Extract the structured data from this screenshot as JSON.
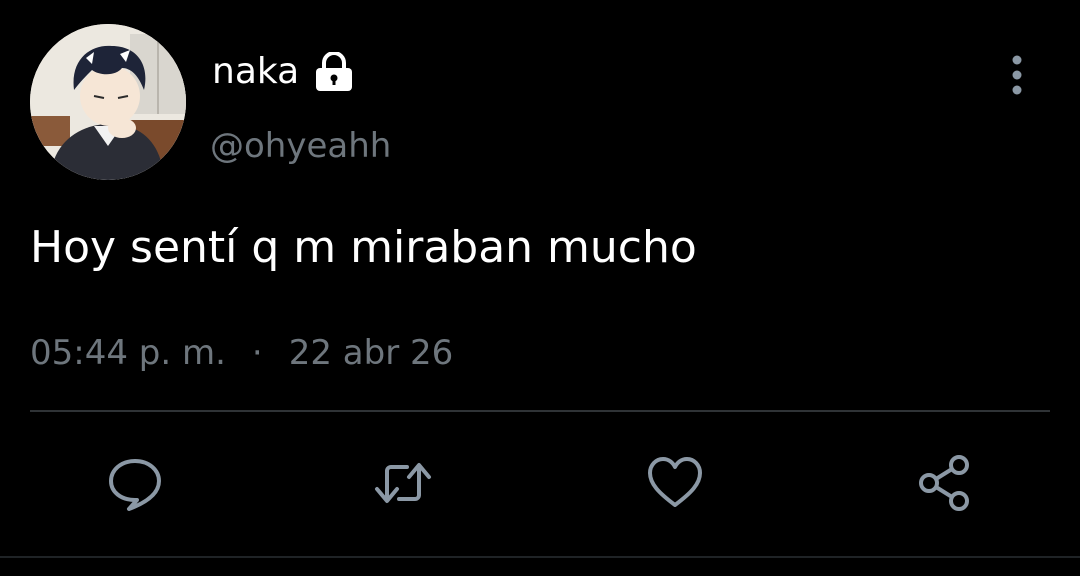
{
  "tweet": {
    "display_name": "naka",
    "handle": "@ohyeahh",
    "protected": true,
    "text": "Hoy sentí q m miraban mucho",
    "time": "05:44 p. m.",
    "separator": "·",
    "date": "22 abr 26"
  },
  "icons": {
    "lock": "lock-icon",
    "more": "more-vertical-icon",
    "reply": "reply-icon",
    "retweet": "retweet-icon",
    "like": "heart-icon",
    "share": "share-icon"
  },
  "colors": {
    "background": "#000000",
    "text_primary": "#ffffff",
    "text_secondary": "#6e767d",
    "icon": "#8b98a5",
    "divider": "#2f3336"
  }
}
